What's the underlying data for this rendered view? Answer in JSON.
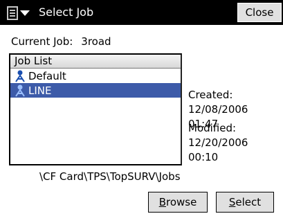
{
  "window": {
    "title": "Select Job",
    "close_label": "Close"
  },
  "current_job": {
    "label": "Current Job:",
    "value": "3road"
  },
  "job_list": {
    "header": "Job List",
    "items": [
      {
        "name": "Default",
        "selected": false
      },
      {
        "name": "LINE",
        "selected": true
      }
    ]
  },
  "details": {
    "created_label": "Created:",
    "created_date": "12/08/2006",
    "created_time": "01:47",
    "modified_label": "Modified:",
    "modified_date": "12/20/2006",
    "modified_time": "00:10"
  },
  "path": "\\CF Card\\TPS\\TopSURV\\Jobs",
  "buttons": {
    "browse_first": "B",
    "browse_rest": "rowse",
    "select_first": "S",
    "select_rest": "elect"
  },
  "colors": {
    "titlebar": "#000000",
    "selection": "#3d5ba9"
  },
  "icons": {
    "menu": "start-menu-icon",
    "job": "job-icon"
  }
}
